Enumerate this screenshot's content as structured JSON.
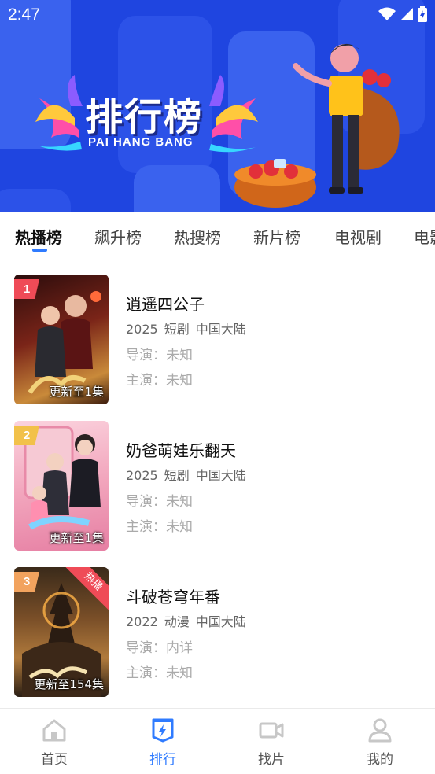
{
  "status_bar": {
    "time": "2:47"
  },
  "banner": {
    "title_cn": "排行榜",
    "title_en": "PAI HANG BANG"
  },
  "tabs": [
    {
      "label": "热播榜",
      "active": true
    },
    {
      "label": "飙升榜",
      "active": false
    },
    {
      "label": "热搜榜",
      "active": false
    },
    {
      "label": "新片榜",
      "active": false
    },
    {
      "label": "电视剧",
      "active": false
    },
    {
      "label": "电影",
      "active": false
    }
  ],
  "list": [
    {
      "rank": "1",
      "rank_color": "#ef4b57",
      "title": "逍遥四公子",
      "year": "2025",
      "genre": "短剧",
      "region": "中国大陆",
      "director": "导演：未知",
      "actors": "主演：未知",
      "update": "更新至1集",
      "poster_colors": [
        "#3a1010",
        "#8a2a1a",
        "#d9a24a"
      ]
    },
    {
      "rank": "2",
      "rank_color": "#f2c14a",
      "title": "奶爸萌娃乐翻天",
      "year": "2025",
      "genre": "短剧",
      "region": "中国大陆",
      "director": "导演：未知",
      "actors": "主演：未知",
      "update": "更新至1集",
      "poster_colors": [
        "#f7b9c9",
        "#e97fa0",
        "#fbe3e9"
      ]
    },
    {
      "rank": "3",
      "rank_color": "#f2a35e",
      "title": "斗破苍穹年番",
      "year": "2022",
      "genre": "动漫",
      "region": "中国大陆",
      "director": "导演：内详",
      "actors": "主演：未知",
      "update": "更新至154集",
      "hot_label": "热播",
      "poster_colors": [
        "#2a1d14",
        "#7a4a22",
        "#c99a55"
      ]
    }
  ],
  "bottom_nav": [
    {
      "label": "首页",
      "icon": "home-icon",
      "active": false
    },
    {
      "label": "排行",
      "icon": "ranking-icon",
      "active": true
    },
    {
      "label": "找片",
      "icon": "video-camera-icon",
      "active": false
    },
    {
      "label": "我的",
      "icon": "person-icon",
      "active": false
    }
  ],
  "colors": {
    "accent": "#2f7bff",
    "banner_bg": "#1f45e0"
  }
}
